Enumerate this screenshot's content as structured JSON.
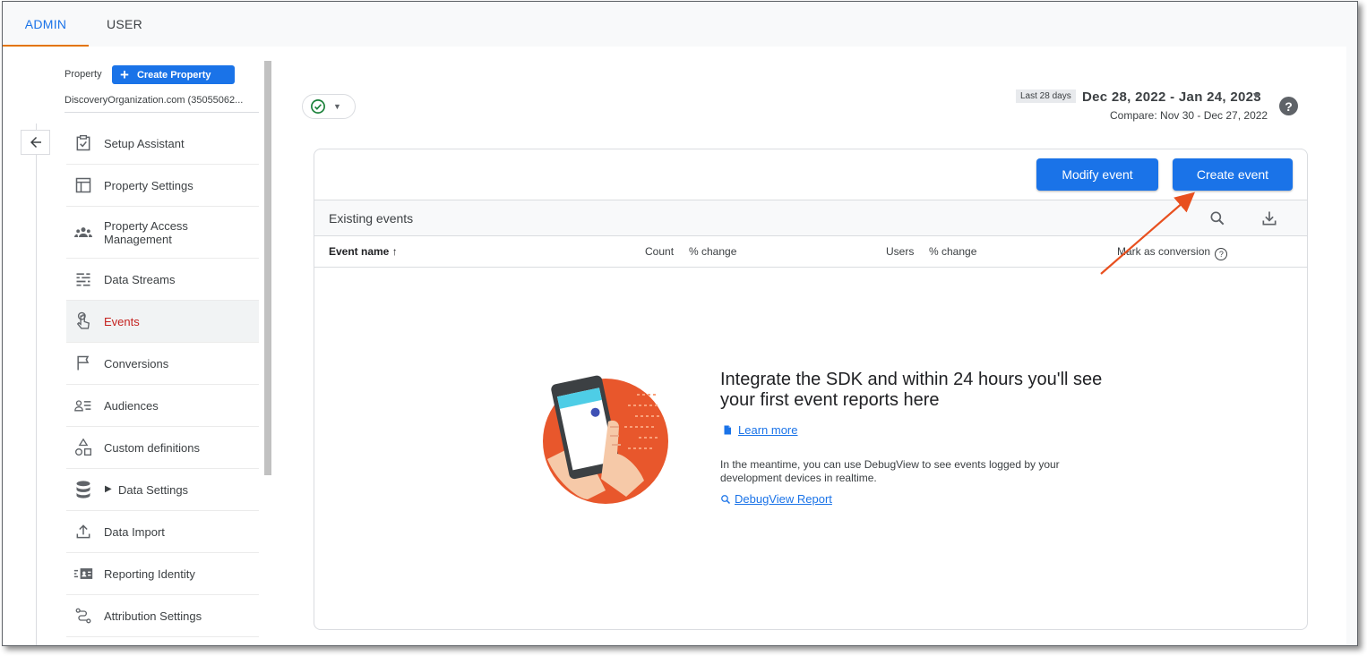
{
  "tabs": {
    "admin": "ADMIN",
    "user": "USER"
  },
  "property": {
    "label": "Property",
    "create_button": "Create Property",
    "name": "DiscoveryOrganization.com (35055062..."
  },
  "nav": {
    "items": [
      {
        "label": "Setup Assistant",
        "icon": "clipboard-check-icon"
      },
      {
        "label": "Property Settings",
        "icon": "layout-icon"
      },
      {
        "label": "Property Access Management",
        "icon": "people-icon"
      },
      {
        "label": "Data Streams",
        "icon": "streams-icon"
      },
      {
        "label": "Events",
        "icon": "touch-icon",
        "active": true
      },
      {
        "label": "Conversions",
        "icon": "flag-icon"
      },
      {
        "label": "Audiences",
        "icon": "audience-icon"
      },
      {
        "label": "Custom definitions",
        "icon": "shapes-icon"
      },
      {
        "label": "Data Settings",
        "icon": "database-icon"
      },
      {
        "label": "Data Import",
        "icon": "upload-icon"
      },
      {
        "label": "Reporting Identity",
        "icon": "identity-icon"
      },
      {
        "label": "Attribution Settings",
        "icon": "attribution-icon"
      }
    ]
  },
  "date_range": {
    "tag": "Last 28 days",
    "value": "Dec 28, 2022 - Jan 24, 2023",
    "compare": "Compare: Nov 30 - Dec 27, 2022"
  },
  "actions": {
    "modify": "Modify event",
    "create": "Create event"
  },
  "events_table": {
    "title": "Existing events",
    "columns": [
      "Event name",
      "Count",
      "% change",
      "Users",
      "% change",
      "Mark as conversion"
    ]
  },
  "empty_state": {
    "title": "Integrate the SDK and within 24 hours you'll see your first event reports here",
    "learn_more": "Learn more",
    "meantime": "In the meantime, you can use DebugView to see events logged by your development devices in realtime.",
    "debug_link": "DebugView Report"
  },
  "colors": {
    "accent": "#1a73e8",
    "active_nav": "#c5221f",
    "tab_indicator": "#e37400",
    "annotation_arrow": "#e8501f"
  }
}
